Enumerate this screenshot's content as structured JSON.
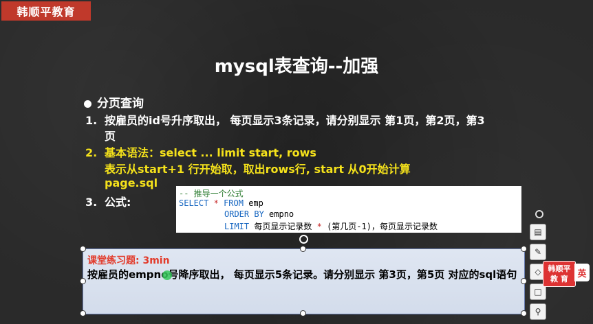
{
  "brand": {
    "text": "韩顺平教育"
  },
  "slide": {
    "title": "mysql表查询--加强",
    "heading": "分页查询",
    "item1_num": "1.",
    "item1_line1": "按雇员的id号升序取出， 每页显示3条记录，请分别显示 第1页，第2页，第3",
    "item1_line2": "页",
    "item2_num": "2.",
    "item2_line1": "基本语法：select ... limit start, rows",
    "item2_line2": "表示从start+1 行开始取，取出rows行, start 从0开始计算",
    "item2_line3": "page.sql",
    "item3_num": "3.",
    "item3_line1": "公式:"
  },
  "code": {
    "line1": "-- 推导一个公式",
    "select_kw": "SELECT",
    "star": "*",
    "from_kw": "FROM",
    "table": "emp",
    "order_kw": "ORDER BY",
    "order_col": "empno",
    "limit_kw": "LIMIT",
    "limit_expr_a": "每页显示记录数",
    "limit_star": "*",
    "limit_expr_b": "(第几页-1)",
    "limit_expr_c": "，每页显示记录数"
  },
  "exercise": {
    "title": "课堂练习题: 3min",
    "body": "按雇员的empno号降序取出， 每页显示5条记录。请分别显示 第3页，第5页 对应的sql语句"
  },
  "toolbar": {
    "btn1_icon": "layers-icon",
    "btn2_icon": "pen-icon",
    "btn3_icon": "eraser-icon",
    "btn4_icon": "square-icon",
    "btn5_icon": "pin-icon"
  },
  "badge": {
    "logo_line1": "韩顺平",
    "logo_line2": "教 育",
    "lang": "英"
  }
}
